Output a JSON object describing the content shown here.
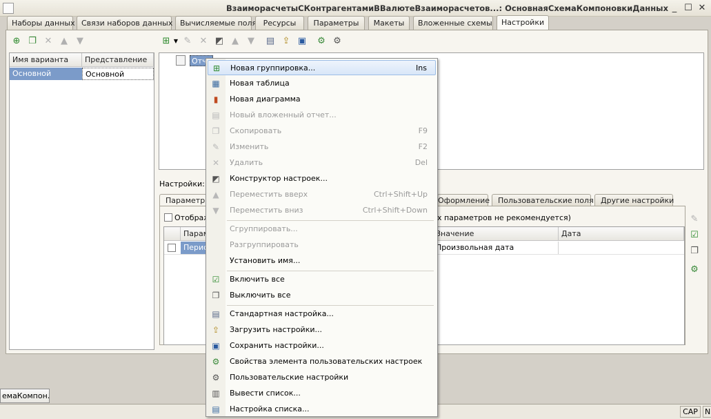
{
  "window": {
    "title": "ВзаиморасчетыСКонтрагентамиВВалютеВзаиморасчетов...: ОсновнаяСхемаКомпоновкиДанных",
    "minimize": "_",
    "maximize": "☐",
    "close": "✕"
  },
  "tabs": [
    {
      "label": "Наборы данных"
    },
    {
      "label": "Связи наборов данных"
    },
    {
      "label": "Вычисляемые поля"
    },
    {
      "label": "Ресурсы"
    },
    {
      "label": "Параметры"
    },
    {
      "label": "Макеты"
    },
    {
      "label": "Вложенные схемы"
    },
    {
      "label": "Настройки"
    }
  ],
  "variants": {
    "headers": [
      "Имя варианта",
      "Представление"
    ],
    "rows": [
      {
        "name": "Основной",
        "presentation": "Основной"
      }
    ]
  },
  "tree": {
    "node_label": "Отче"
  },
  "settings": {
    "label": "Настройки:",
    "tabs": [
      {
        "label": "Параметры"
      },
      {
        "label": "Оформление"
      },
      {
        "label": "Пользовательские поля"
      },
      {
        "label": "Другие настройки"
      }
    ],
    "show_checkbox_label": "Отображ",
    "note": "х параметров не рекомендуется)",
    "grid_headers": [
      "Парам",
      "Значение",
      "Дата"
    ],
    "row": {
      "param": "Перио",
      "value": "Произвольная дата",
      "date": ""
    }
  },
  "context_menu": {
    "items": [
      {
        "label": "Новая группировка...",
        "shortcut": "Ins",
        "icon": "new-grouping-icon",
        "enabled": true,
        "highlighted": true
      },
      {
        "label": "Новая таблица",
        "shortcut": "",
        "icon": "new-table-icon",
        "enabled": true
      },
      {
        "label": "Новая диаграмма",
        "shortcut": "",
        "icon": "new-chart-icon",
        "enabled": true
      },
      {
        "label": "Новый вложенный отчет...",
        "shortcut": "",
        "icon": "nested-report-icon",
        "enabled": false
      },
      {
        "label": "Скопировать",
        "shortcut": "F9",
        "icon": "copy-icon",
        "enabled": false
      },
      {
        "label": "Изменить",
        "shortcut": "F2",
        "icon": "edit-icon",
        "enabled": false
      },
      {
        "label": "Удалить",
        "shortcut": "Del",
        "icon": "delete-icon",
        "enabled": false
      },
      {
        "label": "Конструктор настроек...",
        "shortcut": "",
        "icon": "settings-wizard-icon",
        "enabled": true
      },
      {
        "label": "Переместить вверх",
        "shortcut": "Ctrl+Shift+Up",
        "icon": "arrow-up-icon",
        "enabled": false
      },
      {
        "label": "Переместить вниз",
        "shortcut": "Ctrl+Shift+Down",
        "icon": "arrow-down-icon",
        "enabled": false
      },
      {
        "separator": true
      },
      {
        "label": "Сгруппировать...",
        "shortcut": "",
        "icon": "",
        "enabled": false
      },
      {
        "label": "Разгруппировать",
        "shortcut": "",
        "icon": "",
        "enabled": false
      },
      {
        "label": "Установить имя...",
        "shortcut": "",
        "icon": "",
        "enabled": true
      },
      {
        "separator": true
      },
      {
        "label": "Включить все",
        "shortcut": "",
        "icon": "check-all-icon",
        "enabled": true
      },
      {
        "label": "Выключить все",
        "shortcut": "",
        "icon": "uncheck-all-icon",
        "enabled": true
      },
      {
        "separator": true
      },
      {
        "label": "Стандартная настройка...",
        "shortcut": "",
        "icon": "standard-settings-icon",
        "enabled": true
      },
      {
        "label": "Загрузить настройки...",
        "shortcut": "",
        "icon": "load-settings-icon",
        "enabled": true
      },
      {
        "label": "Сохранить настройки...",
        "shortcut": "",
        "icon": "save-settings-icon",
        "enabled": true
      },
      {
        "label": "Свойства элемента пользовательских настроек",
        "shortcut": "",
        "icon": "user-setting-props-icon",
        "enabled": true
      },
      {
        "label": "Пользовательские настройки",
        "shortcut": "",
        "icon": "user-settings-icon",
        "enabled": true
      },
      {
        "label": "Вывести список...",
        "shortcut": "",
        "icon": "print-list-icon",
        "enabled": true
      },
      {
        "label": "Настройка списка...",
        "shortcut": "",
        "icon": "list-settings-icon",
        "enabled": true
      }
    ]
  },
  "taskbar": {
    "item": "емаКомпон..."
  },
  "status": {
    "cap": "CAP",
    "num": "N"
  },
  "colors": {
    "selection": "#7b9bc9",
    "highlight": "#d8e6f8"
  }
}
